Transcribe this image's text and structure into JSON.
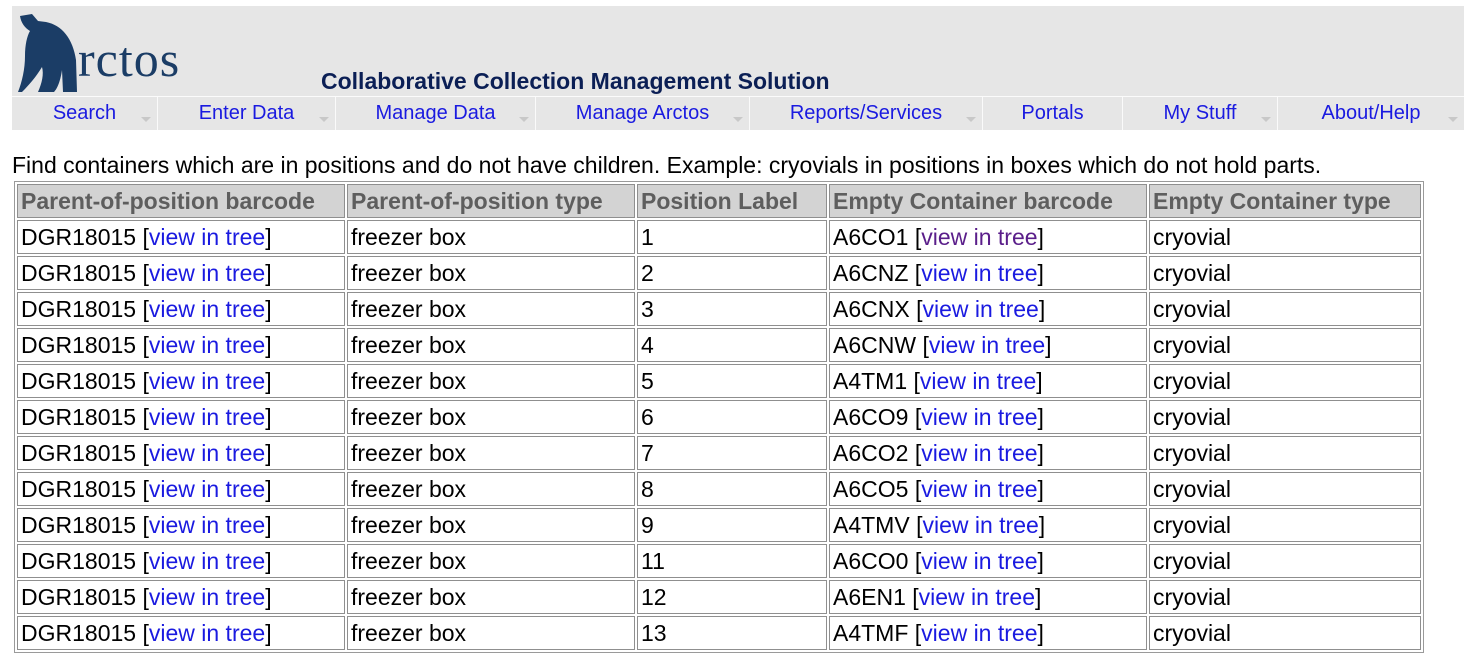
{
  "brand": {
    "logo_text": "rctos",
    "subtitle": "Collaborative Collection Management Solution",
    "colors": {
      "logo": "#1b3d66",
      "subtitle": "#0b1f55",
      "link": "#1a1ae0",
      "visited_link": "#5a1e8a"
    }
  },
  "nav": {
    "items": [
      {
        "label": "Search"
      },
      {
        "label": "Enter Data"
      },
      {
        "label": "Manage Data"
      },
      {
        "label": "Manage Arctos"
      },
      {
        "label": "Reports/Services"
      },
      {
        "label": "Portals"
      },
      {
        "label": "My Stuff"
      },
      {
        "label": "About/Help"
      }
    ]
  },
  "intro": "Find containers which are in positions and do not have children. Example: cryovials in positions in boxes which do not hold parts.",
  "table": {
    "link_label": "view in tree",
    "columns": [
      "Parent-of-position barcode",
      "Parent-of-position type",
      "Position Label",
      "Empty Container barcode",
      "Empty Container type"
    ],
    "rows": [
      {
        "parent_barcode": "DGR18015",
        "parent_type": "freezer box",
        "position": "1",
        "container_barcode": "A6CO1",
        "container_type": "cryovial"
      },
      {
        "parent_barcode": "DGR18015",
        "parent_type": "freezer box",
        "position": "2",
        "container_barcode": "A6CNZ",
        "container_type": "cryovial"
      },
      {
        "parent_barcode": "DGR18015",
        "parent_type": "freezer box",
        "position": "3",
        "container_barcode": "A6CNX",
        "container_type": "cryovial"
      },
      {
        "parent_barcode": "DGR18015",
        "parent_type": "freezer box",
        "position": "4",
        "container_barcode": "A6CNW",
        "container_type": "cryovial"
      },
      {
        "parent_barcode": "DGR18015",
        "parent_type": "freezer box",
        "position": "5",
        "container_barcode": "A4TM1",
        "container_type": "cryovial"
      },
      {
        "parent_barcode": "DGR18015",
        "parent_type": "freezer box",
        "position": "6",
        "container_barcode": "A6CO9",
        "container_type": "cryovial"
      },
      {
        "parent_barcode": "DGR18015",
        "parent_type": "freezer box",
        "position": "7",
        "container_barcode": "A6CO2",
        "container_type": "cryovial"
      },
      {
        "parent_barcode": "DGR18015",
        "parent_type": "freezer box",
        "position": "8",
        "container_barcode": "A6CO5",
        "container_type": "cryovial"
      },
      {
        "parent_barcode": "DGR18015",
        "parent_type": "freezer box",
        "position": "9",
        "container_barcode": "A4TMV",
        "container_type": "cryovial"
      },
      {
        "parent_barcode": "DGR18015",
        "parent_type": "freezer box",
        "position": "11",
        "container_barcode": "A6CO0",
        "container_type": "cryovial"
      },
      {
        "parent_barcode": "DGR18015",
        "parent_type": "freezer box",
        "position": "12",
        "container_barcode": "A6EN1",
        "container_type": "cryovial"
      },
      {
        "parent_barcode": "DGR18015",
        "parent_type": "freezer box",
        "position": "13",
        "container_barcode": "A4TMF",
        "container_type": "cryovial"
      }
    ]
  }
}
